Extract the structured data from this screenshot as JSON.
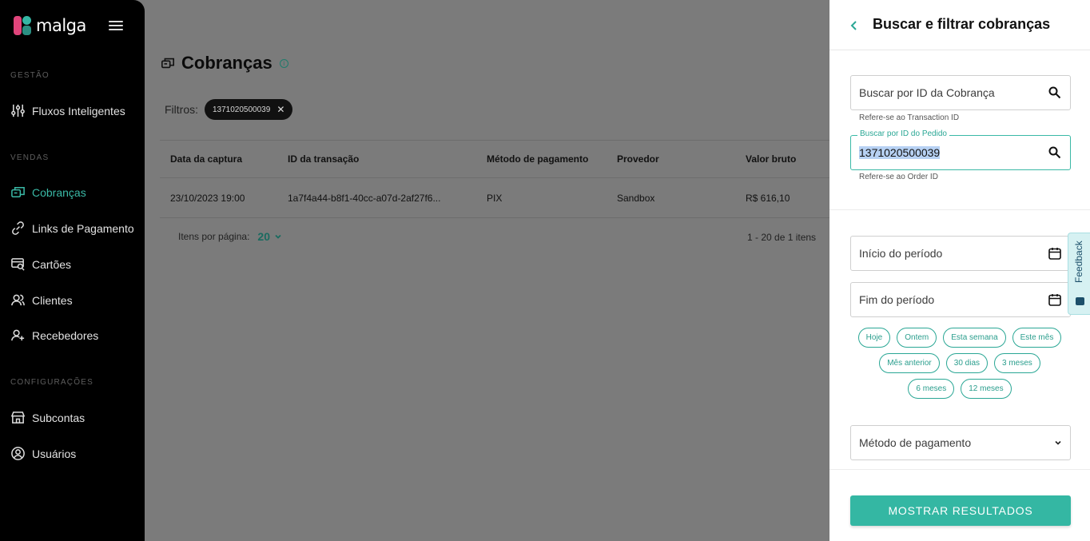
{
  "sidebar": {
    "logo_text": "malga",
    "sections": {
      "gestao": "GESTÃO",
      "vendas": "VENDAS",
      "config": "CONFIGURAÇÕES"
    },
    "items": {
      "fluxos": "Fluxos Inteligentes",
      "cobrancas": "Cobranças",
      "links": "Links de Pagamento",
      "cartoes": "Cartões",
      "clientes": "Clientes",
      "recebedores": "Recebedores",
      "subcontas": "Subcontas",
      "usuarios": "Usuários"
    },
    "active_color": "#3ab9a6"
  },
  "main": {
    "title": "Cobranças",
    "filters_label": "Filtros:",
    "filter_chip": "1371020500039",
    "table": {
      "headers": [
        "Data da captura",
        "ID da transação",
        "Método de pagamento",
        "Provedor",
        "Valor bruto"
      ],
      "rows": [
        [
          "23/10/2023 19:00",
          "1a7f4a44-b8f1-40cc-a07d-2af27f6...",
          "PIX",
          "Sandbox",
          "R$ 616,10"
        ]
      ]
    },
    "pager": {
      "label": "Itens por página:",
      "value": "20",
      "range": "1 - 20 de 1 itens"
    }
  },
  "panel": {
    "title": "Buscar e filtrar cobranças",
    "charge_search": {
      "placeholder": "Buscar por ID da Cobrança",
      "hint": "Refere-se ao Transaction ID"
    },
    "order_search": {
      "label": "Buscar por ID do Pedido",
      "value": "1371020500039",
      "hint": "Refere-se ao Order ID"
    },
    "period_start": "Início do período",
    "period_end": "Fim do período",
    "quick_ranges": [
      [
        "Hoje",
        "Ontem",
        "Esta semana",
        "Este mês"
      ],
      [
        "Mês anterior",
        "30 dias",
        "3 meses"
      ],
      [
        "6 meses",
        "12 meses"
      ]
    ],
    "payment_method": "Método de pagamento",
    "submit": "MOSTRAR RESULTADOS",
    "accent": "#34b7a3"
  },
  "feedback": "Feedback"
}
